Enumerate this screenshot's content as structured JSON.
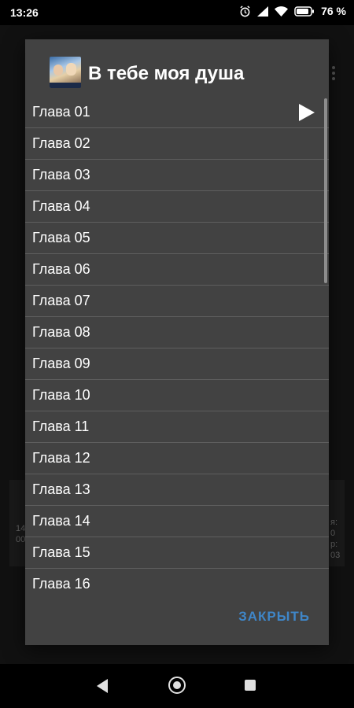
{
  "status_bar": {
    "time": "13:26",
    "battery_percent": "76 %",
    "icons": [
      "alarm-icon",
      "signal-icon",
      "wifi-icon",
      "battery-icon"
    ]
  },
  "background_app": {
    "left_text_1": "14",
    "left_text_2": "00",
    "right_text_1": "я:",
    "right_text_2": "0",
    "right_text_3": "р:",
    "right_text_4": "03"
  },
  "dialog": {
    "title": "В тебе моя душа",
    "chapters": [
      "Глава 01",
      "Глава 02",
      "Глава 03",
      "Глава 04",
      "Глава 05",
      "Глава 06",
      "Глава 07",
      "Глава 08",
      "Глава 09",
      "Глава 10",
      "Глава 11",
      "Глава 12",
      "Глава 13",
      "Глава 14",
      "Глава 15",
      "Глава 16"
    ],
    "playing_index": 0,
    "close_label": "ЗАКРЫТЬ"
  },
  "colors": {
    "dialog_bg": "#424242",
    "accent": "#3f86c8",
    "divider": "#5e5e5e"
  }
}
